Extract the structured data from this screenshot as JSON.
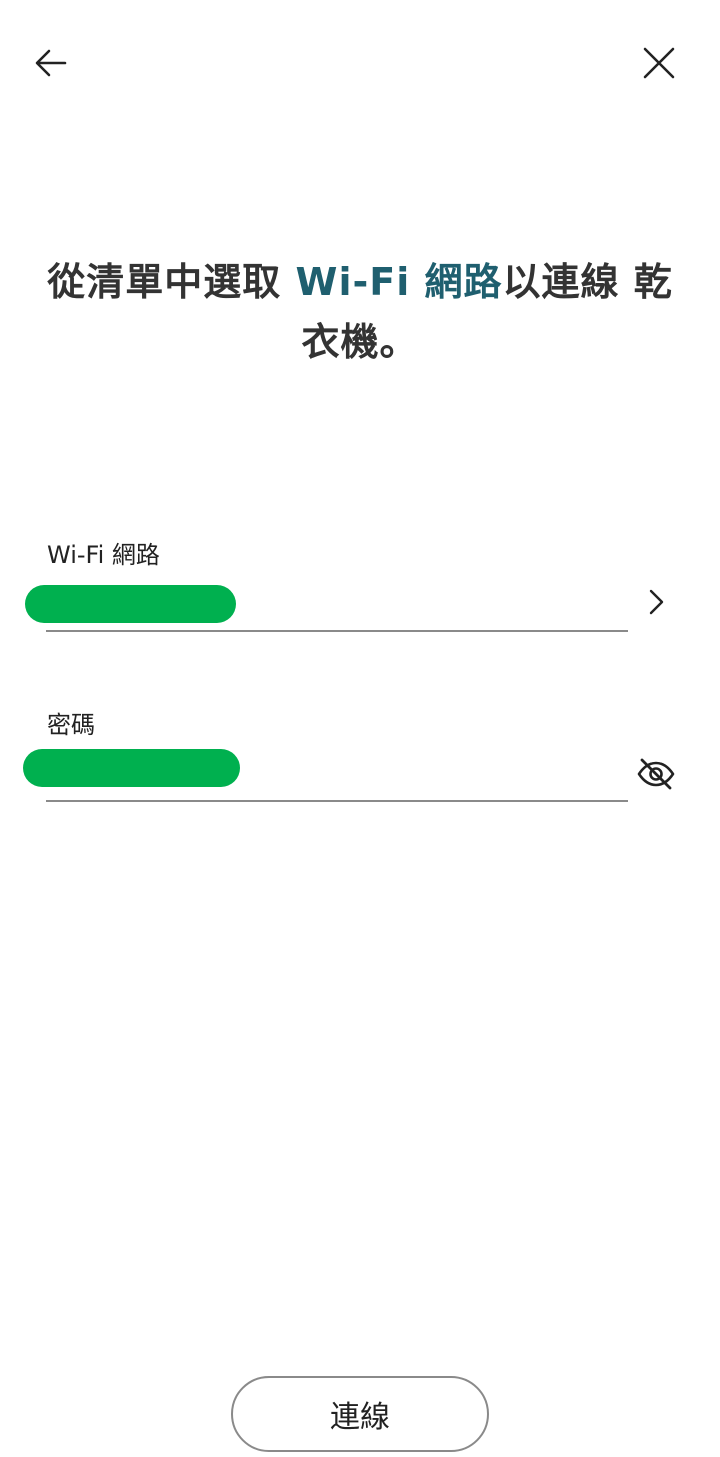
{
  "header": {
    "back_icon": "arrow-left-icon",
    "close_icon": "close-icon"
  },
  "title": {
    "part1": "從清單中選取 ",
    "accent": "Wi-Fi 網路",
    "part2": "以連線 乾衣機。"
  },
  "wifi_field": {
    "label": "Wi-Fi 網路",
    "value": "",
    "value_redacted": true,
    "action_icon": "chevron-right-icon"
  },
  "password_field": {
    "label": "密碼",
    "value": "",
    "value_redacted": true,
    "action_icon": "eye-off-icon"
  },
  "connect_button": {
    "label": "連線"
  },
  "colors": {
    "accent": "#1f5f6f",
    "redaction": "#00b04f",
    "underline": "#8a8a8a",
    "text": "#222222"
  }
}
